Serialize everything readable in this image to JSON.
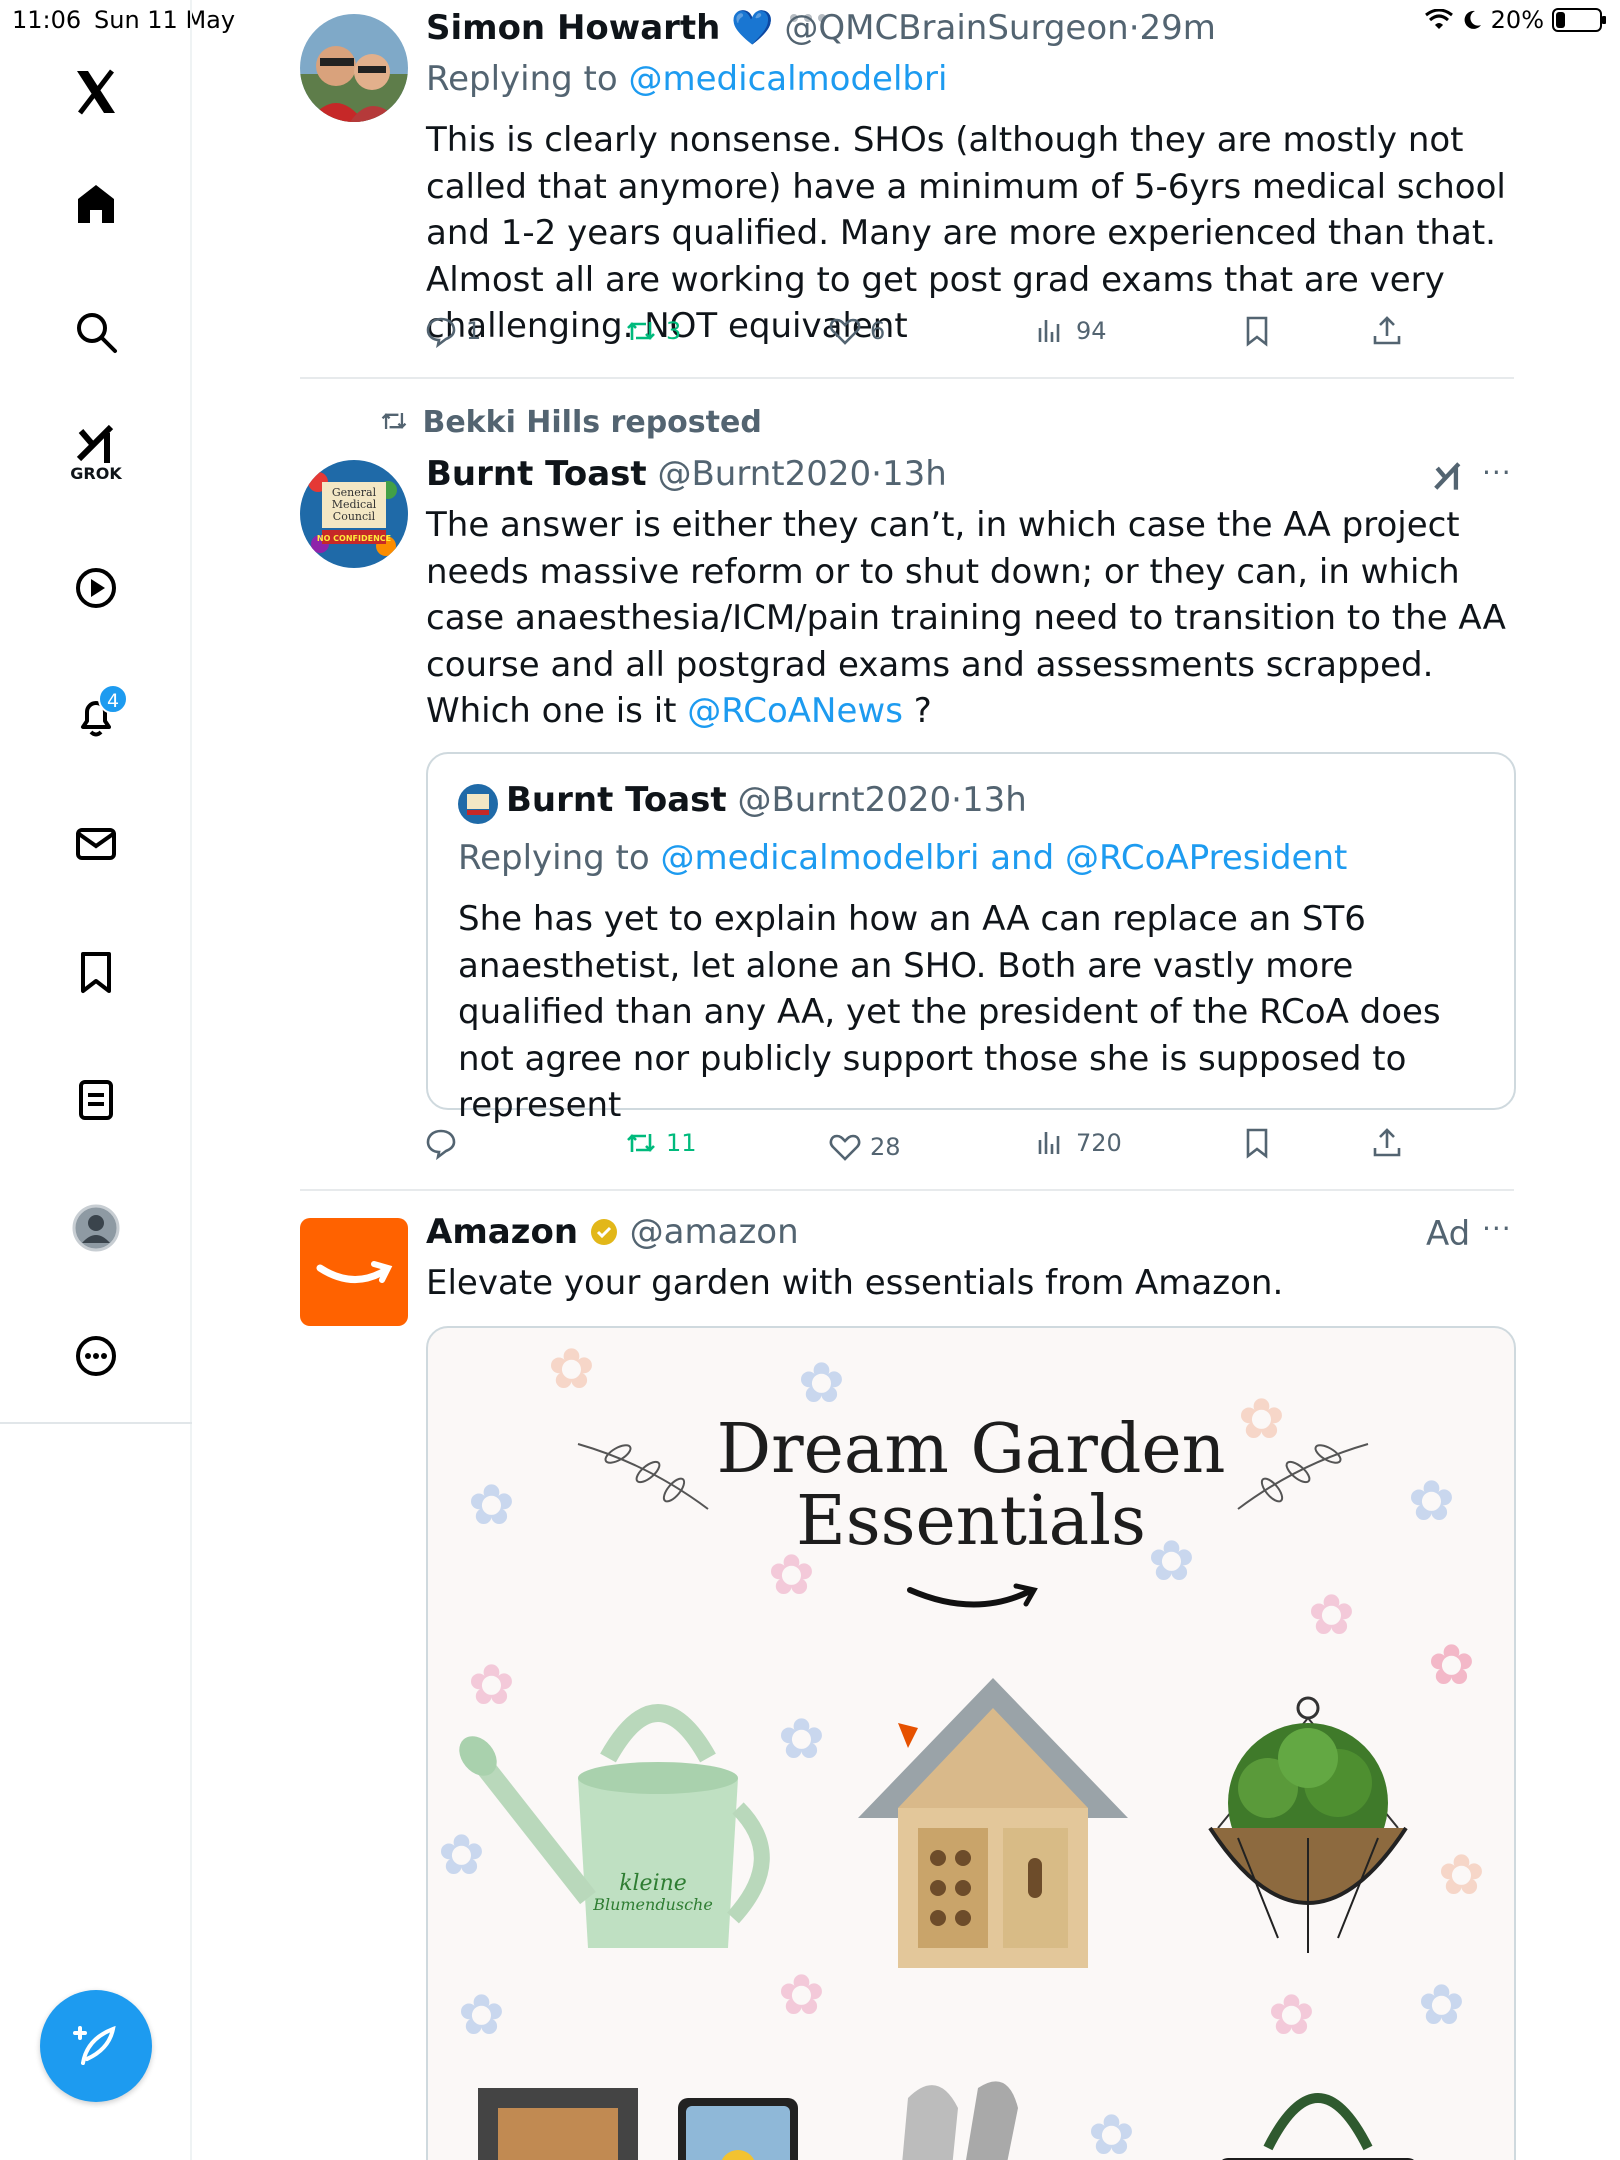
{
  "status_bar": {
    "time": "11:06",
    "date": "Sun 11 May",
    "battery": "20%",
    "battery_level": 0.2
  },
  "sidebar": {
    "items": [
      {
        "name": "X"
      },
      {
        "name": "Home"
      },
      {
        "name": "Explore"
      },
      {
        "name": "Grok",
        "label": "GROK"
      },
      {
        "name": "Video"
      },
      {
        "name": "Notifications",
        "badge": "4"
      },
      {
        "name": "Messages"
      },
      {
        "name": "Bookmarks"
      },
      {
        "name": "Lists"
      },
      {
        "name": "Profile"
      },
      {
        "name": "More"
      }
    ]
  },
  "tweets": [
    {
      "name": "Simon Howarth",
      "verified_emoji": "💙",
      "handle": "@QMCBrainSurgeon",
      "sep": "·",
      "time": "29m",
      "replying_prefix": "Replying to",
      "replying_to": "@medicalmodelbri",
      "text": "This is clearly nonsense. SHOs (although they are mostly not called that anymore) have a minimum of 5-6yrs medical school and 1-2 years qualified. Many are more experienced than that. Almost all are working to get post grad exams that are very challenging. NOT equivalent",
      "replies": "1",
      "reposts": "3",
      "likes": "6",
      "views": "94"
    },
    {
      "repost_label": "Bekki Hills reposted",
      "name": "Burnt Toast",
      "handle": "@Burnt2020",
      "sep": "·",
      "time": "13h",
      "text": "The answer is either they can’t, in which case the AA project needs massive reform or to shut down; or they can, in which case anaesthesia/ICM/pain training need to transition to the AA course and all postgrad exams and assessments scrapped. Which one is it",
      "mention": "@RCoANews",
      "text_end": " ?",
      "avatar_text": [
        "General",
        "Medical",
        "Council",
        "NO CONFIDENCE"
      ],
      "quote": {
        "name": "Burnt Toast",
        "handle": "@Burnt2020",
        "sep": "·",
        "time": "13h",
        "replying_prefix": "Replying to",
        "replying_to": "@medicalmodelbri and @RCoAPresident",
        "text": "She has yet to explain how an AA can replace an ST6 anaesthetist, let alone an SHO. Both are vastly more qualified than any AA, yet the president of the RCoA does not agree nor publicly support those she is supposed to represent"
      },
      "replies": "",
      "reposts": "11",
      "likes": "28",
      "views": "720"
    },
    {
      "name": "Amazon",
      "handle": "@amazon",
      "ad_label": "Ad",
      "text": "Elevate your garden with essentials from Amazon.",
      "ad_image": {
        "title_line1": "Dream Garden",
        "title_line2": "Essentials",
        "can_text_line1": "kleine",
        "can_text_line2": "Blumendusche"
      }
    }
  ],
  "colors": {
    "accent": "#1d9bf0",
    "repost_green": "#00ba7c",
    "muted": "#536471",
    "amazon_orange": "#ff6200",
    "gold_badge": "#e2b719"
  }
}
